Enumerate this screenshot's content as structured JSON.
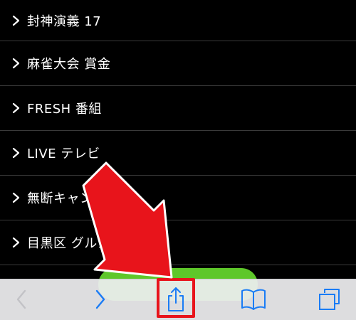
{
  "list": {
    "items": [
      {
        "label": "封神演義 17"
      },
      {
        "label": "麻雀大会 賞金"
      },
      {
        "label": "FRESH 番組"
      },
      {
        "label": "LIVE テレビ"
      },
      {
        "label": "無断キャンセ"
      },
      {
        "label": "目黒区 グルメ"
      }
    ]
  },
  "toolbar": {
    "back_icon": "chevron-left-icon",
    "forward_icon": "chevron-right-icon",
    "share_icon": "share-icon",
    "bookmarks_icon": "book-icon",
    "tabs_icon": "tabs-icon"
  },
  "colors": {
    "background": "#000000",
    "accent_blue": "#1a7cf5",
    "disabled_gray": "#c2c2c6",
    "annotation_red": "#e8141b",
    "green_button": "#5ec72a"
  }
}
